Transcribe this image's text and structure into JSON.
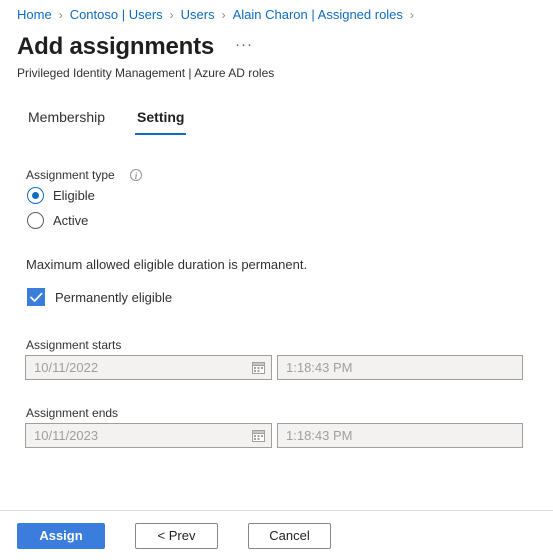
{
  "breadcrumb": {
    "separator": "›",
    "items": [
      {
        "label": "Home"
      },
      {
        "label": "Contoso | Users"
      },
      {
        "label": "Users"
      },
      {
        "label": "Alain Charon | Assigned roles"
      }
    ]
  },
  "header": {
    "title": "Add assignments",
    "more_label": "···",
    "subtitle": "Privileged Identity Management | Azure AD roles"
  },
  "tabs": [
    {
      "label": "Membership",
      "active": false
    },
    {
      "label": "Setting",
      "active": true
    }
  ],
  "form": {
    "assignment_type": {
      "label": "Assignment type",
      "info_glyph": "i",
      "options": [
        {
          "label": "Eligible",
          "selected": true
        },
        {
          "label": "Active",
          "selected": false
        }
      ]
    },
    "duration_note": "Maximum allowed eligible duration is permanent.",
    "permanent_checkbox": {
      "label": "Permanently eligible",
      "checked": true
    },
    "assignment_starts": {
      "label": "Assignment starts",
      "date_value": "10/11/2022",
      "date_placeholder": "10/11/2022",
      "time_value": "1:18:43 PM",
      "time_placeholder": "1:18:43 PM",
      "disabled": true
    },
    "assignment_ends": {
      "label": "Assignment ends",
      "date_value": "10/11/2023",
      "date_placeholder": "10/11/2023",
      "time_value": "1:18:43 PM",
      "time_placeholder": "1:18:43 PM",
      "disabled": true
    }
  },
  "footer": {
    "assign_label": "Assign",
    "prev_label": "< Prev",
    "cancel_label": "Cancel"
  },
  "colors": {
    "accent_blue": "#0f6cbd",
    "button_blue": "#3b7ddd",
    "link_blue": "#0f6cbd",
    "disabled_text": "#a19f9d",
    "border_gray": "#a19f9d",
    "text_primary": "#323130"
  }
}
